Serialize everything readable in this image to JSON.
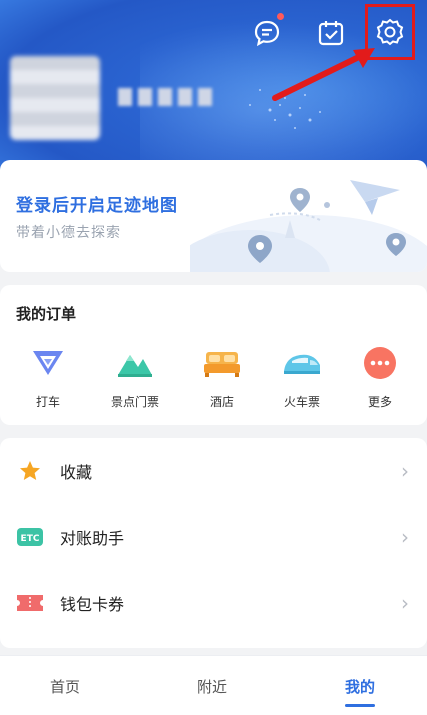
{
  "header": {
    "icons": [
      "message-icon",
      "checkin-calendar-icon",
      "gear-icon"
    ],
    "highlight_color": "#e21b1b"
  },
  "footprint": {
    "title": "登录后开启足迹地图",
    "subtitle": "带着小德去探索"
  },
  "orders": {
    "title": "我的订单",
    "items": [
      {
        "label": "打车",
        "icon": "taxi-icon"
      },
      {
        "label": "景点门票",
        "icon": "scenic-ticket-icon"
      },
      {
        "label": "酒店",
        "icon": "hotel-icon"
      },
      {
        "label": "火车票",
        "icon": "train-ticket-icon"
      },
      {
        "label": "更多",
        "icon": "more-icon"
      }
    ]
  },
  "menu": {
    "items": [
      {
        "label": "收藏",
        "icon": "star-icon"
      },
      {
        "label": "对账助手",
        "icon": "etc-icon"
      },
      {
        "label": "钱包卡券",
        "icon": "ticket-icon"
      }
    ]
  },
  "bottom_nav": {
    "tabs": [
      "首页",
      "附近",
      "我的"
    ],
    "active": "我的"
  },
  "colors": {
    "accent": "#2f6fe0",
    "header_blue": "#2a63d0"
  }
}
